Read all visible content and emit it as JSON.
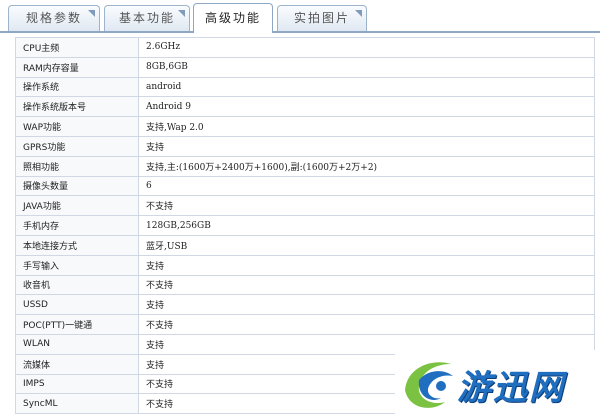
{
  "tabs": [
    {
      "label": "规格参数"
    },
    {
      "label": "基本功能"
    },
    {
      "label": "高级功能"
    },
    {
      "label": "实拍图片"
    }
  ],
  "specs": [
    {
      "key": "CPU主频",
      "value": "2.6GHz"
    },
    {
      "key": "RAM内存容量",
      "value": "8GB,6GB"
    },
    {
      "key": "操作系统",
      "value": "android"
    },
    {
      "key": "操作系统版本号",
      "value": "Android 9"
    },
    {
      "key": "WAP功能",
      "value": "支持,Wap 2.0"
    },
    {
      "key": "GPRS功能",
      "value": "支持"
    },
    {
      "key": "照相功能",
      "value": "支持,主:(1600万+2400万+1600),副:(1600万+2万+2)"
    },
    {
      "key": "摄像头数量",
      "value": "6"
    },
    {
      "key": "JAVA功能",
      "value": "不支持"
    },
    {
      "key": "手机内存",
      "value": "128GB,256GB"
    },
    {
      "key": "本地连接方式",
      "value": "蓝牙,USB"
    },
    {
      "key": "手写输入",
      "value": "支持"
    },
    {
      "key": "收音机",
      "value": "不支持"
    },
    {
      "key": "USSD",
      "value": "支持"
    },
    {
      "key": "POC(PTT)一键通",
      "value": "不支持"
    },
    {
      "key": "WLAN",
      "value": "支持"
    },
    {
      "key": "流媒体",
      "value": "支持"
    },
    {
      "key": "IMPS",
      "value": "不支持"
    },
    {
      "key": "SyncML",
      "value": "不支持"
    }
  ],
  "watermark": {
    "text": "游迅网"
  },
  "colors": {
    "tab_border": "#8ea8c4",
    "grid": "#cfd8e3",
    "logo_blue": "#1f6ec0",
    "logo_green": "#7cc242"
  }
}
